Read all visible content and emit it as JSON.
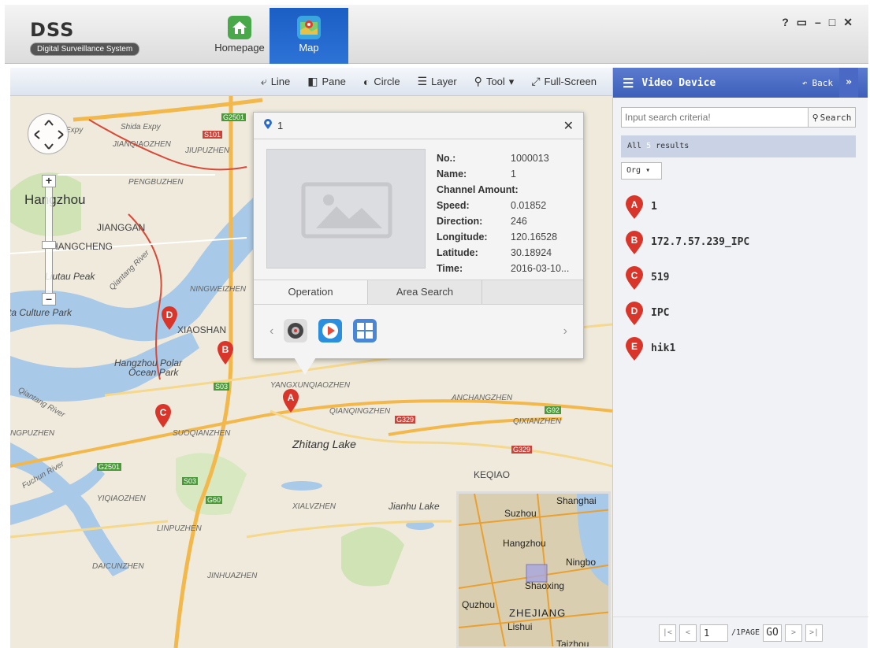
{
  "app": {
    "title": "DSS",
    "subtitle": "Digital Surveillance System"
  },
  "tabs": [
    {
      "label": "Homepage",
      "icon": "home-icon"
    },
    {
      "label": "Map",
      "icon": "map-icon"
    }
  ],
  "window_controls": [
    "?",
    "lock",
    "minimize",
    "maximize",
    "close"
  ],
  "toolbar": {
    "line": "Line",
    "pane": "Pane",
    "circle": "Circle",
    "layer": "Layer",
    "tool": "Tool",
    "fullscreen": "Full-Screen"
  },
  "map": {
    "labels": {
      "hangzhou": "Hangzhou",
      "jianggan": "JIANGGAN",
      "shangcheng": "HANGCHENG",
      "liutau": "Liutau Peak",
      "culture": "ta Culture Park",
      "xiaoshan": "XIAOSHAN",
      "polar": "Hangzhou Polar",
      "ocean": "Ocean Park",
      "zhitang": "Zhitang Lake",
      "keqiao": "KEQIAO",
      "jianhu": "Jianhu Lake",
      "suoqian": "SUOQIANZHEN",
      "ningwei": "NINGWEIZHEN",
      "jianqiao": "JIANQIAOZHEN",
      "jiupu": "JIUPUZHEN",
      "qiantang": "Qiantang River",
      "yangxun": "YANGXUNQIAOZHEN",
      "qianqing": "QIANQINGZHEN",
      "anchang": "ANCHANGZHEN",
      "qixian": "QIXIANZHEN",
      "yiqiao": "YIQIAOZHEN",
      "linpu": "LINPUZHEN",
      "daicun": "DAICUNZHEN",
      "jinhua": "JINHUAZHEN",
      "xialv": "XIALVZHEN",
      "gpuzhen": "NGPUZHEN",
      "fuchun": "Fuchun River",
      "shida": "Shida Expy",
      "pengbu": "PENGBUZHEN"
    },
    "road_badges": [
      "G2501",
      "S101",
      "S03",
      "G329",
      "G92",
      "G60",
      "S03",
      "G2501",
      "G329"
    ],
    "pins": [
      "A",
      "B",
      "C",
      "D"
    ]
  },
  "popup": {
    "title": "1",
    "fields": [
      {
        "key": "No.:",
        "value": "1000013"
      },
      {
        "key": "Name:",
        "value": "1"
      },
      {
        "key": "Channel Amount:",
        "value": ""
      },
      {
        "key": "Speed:",
        "value": "0.01852"
      },
      {
        "key": "Direction:",
        "value": "246"
      },
      {
        "key": "Longitude:",
        "value": "120.16528"
      },
      {
        "key": "Latitude:",
        "value": "30.18924"
      },
      {
        "key": "Time:",
        "value": "2016-03-10..."
      }
    ],
    "tabs": [
      "Operation",
      "Area Search"
    ]
  },
  "minimap": {
    "labels": [
      "Shanghai",
      "Suzhou",
      "Hangzhou",
      "Ningbo",
      "Shaoxing",
      "Quzhou",
      "ZHEJIANG",
      "Lishui",
      "Taizhou"
    ]
  },
  "side": {
    "title": "Video Device",
    "back": "Back",
    "search_placeholder": "Input search criteria!",
    "search_btn": "Search",
    "results_prefix": "All ",
    "results_count": "5",
    "results_suffix": " results",
    "org": "Org",
    "devices": [
      {
        "letter": "A",
        "name": "1"
      },
      {
        "letter": "B",
        "name": "172.7.57.239_IPC"
      },
      {
        "letter": "C",
        "name": "519"
      },
      {
        "letter": "D",
        "name": "IPC"
      },
      {
        "letter": "E",
        "name": "hik1"
      }
    ],
    "pager": {
      "page": "1",
      "total": "/1PAGE",
      "go": "GO"
    }
  }
}
